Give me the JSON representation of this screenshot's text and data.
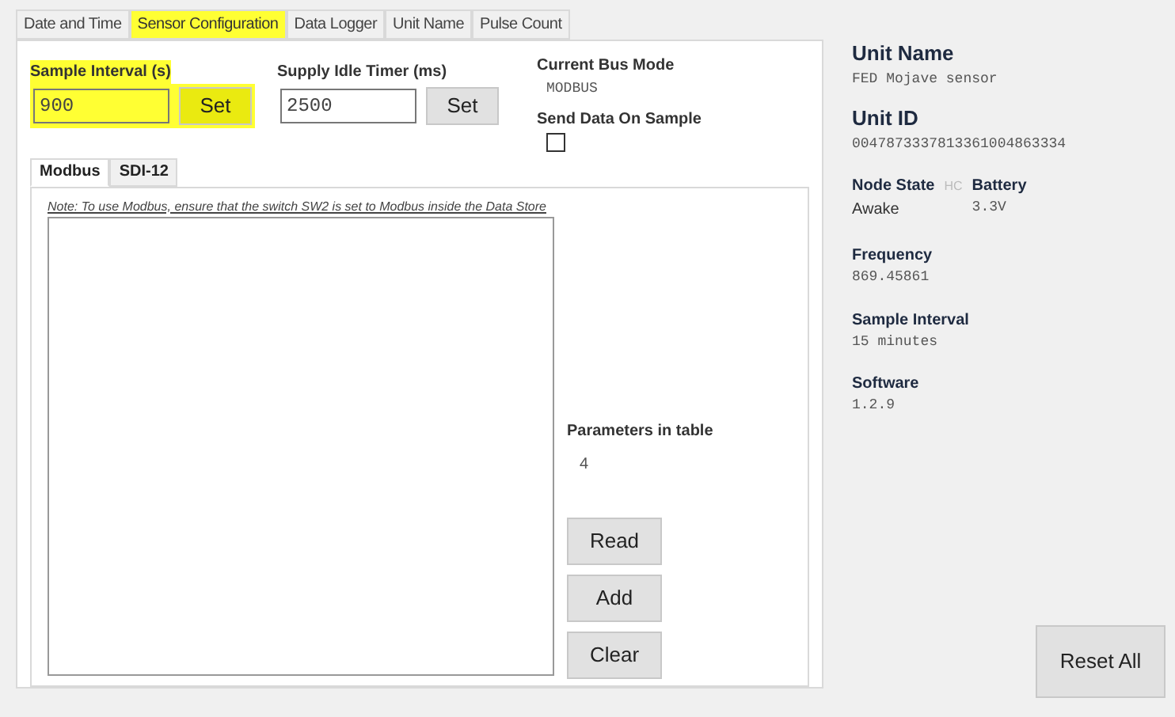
{
  "tabs": [
    {
      "label": "Date and Time",
      "selected": false
    },
    {
      "label": "Sensor Configuration",
      "selected": true
    },
    {
      "label": "Data Logger",
      "selected": false
    },
    {
      "label": "Unit Name",
      "selected": false
    },
    {
      "label": "Pulse Count",
      "selected": false
    }
  ],
  "settings": [
    {
      "label": "Sample Interval (s)",
      "value": "900",
      "button": "Set",
      "highlighted": true
    },
    {
      "label": "Supply Idle Timer (ms)",
      "value": "2500",
      "button": "Set",
      "highlighted": false
    }
  ],
  "bus_mode": {
    "label": "Current Bus Mode",
    "value": "MODBUS"
  },
  "send_data": {
    "label": "Send Data On Sample",
    "checked": false
  },
  "sub_tabs": [
    {
      "label": "Modbus",
      "selected": true
    },
    {
      "label": "SDI-12",
      "selected": false
    }
  ],
  "note": "Note: To use Modbus, ensure that the switch SW2 is set to Modbus inside the Data Store",
  "parameters": {
    "label": "Parameters in table",
    "value": "4"
  },
  "table_buttons": [
    "Read",
    "Add",
    "Clear"
  ],
  "info": {
    "unit_name": {
      "label": "Unit Name",
      "value": "FED Mojave sensor"
    },
    "unit_id": {
      "label": "Unit ID",
      "value": "0047873337813361004863334"
    },
    "node_state": {
      "label": "Node State",
      "value": "Awake",
      "flag": "HC"
    },
    "battery": {
      "label": "Battery",
      "value": "3.3V"
    },
    "fields": [
      {
        "label": "Frequency",
        "value": "869.45861"
      },
      {
        "label": "Sample Interval",
        "value": "15 minutes"
      },
      {
        "label": "Software",
        "value": "1.2.9"
      }
    ]
  },
  "reset_button": "Reset All"
}
